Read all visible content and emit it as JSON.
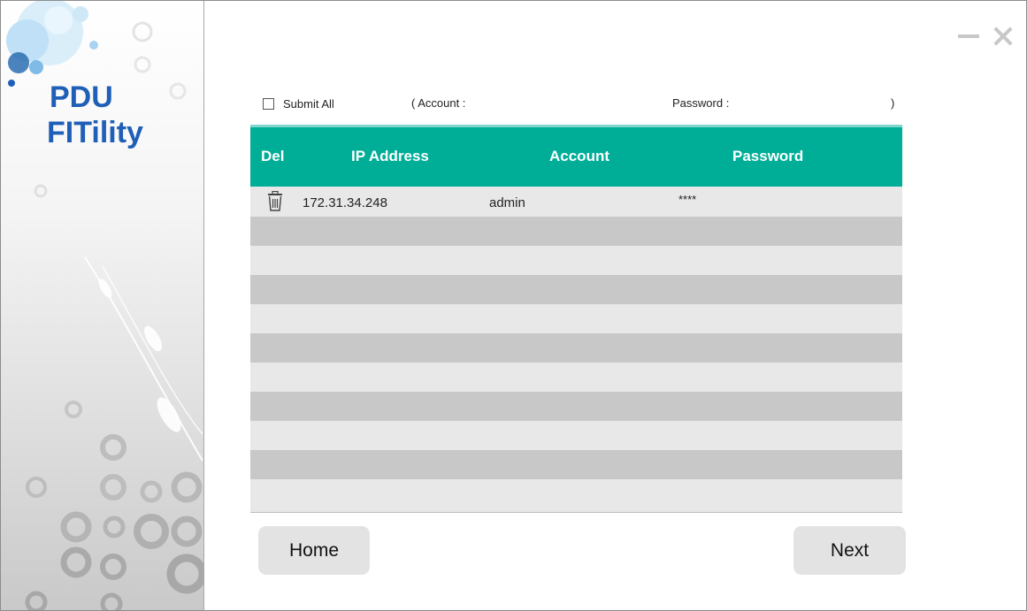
{
  "app": {
    "brand_line1": "PDU",
    "brand_line2": "FITility",
    "brand_color": "#1f5fb8",
    "accent_color": "#00ae98"
  },
  "window_controls": {
    "minimize_icon": "minimize-icon",
    "close_icon": "close-icon"
  },
  "form": {
    "submit_all_label": "Submit All",
    "submit_all_checked": false,
    "account_label": "( Account :",
    "password_label": "Password :",
    "close_paren": ")"
  },
  "table": {
    "columns": [
      "Del",
      "IP Address",
      "Account",
      "Password"
    ],
    "rows": [
      {
        "ip": "172.31.34.248",
        "account": "admin",
        "password": "****"
      },
      {
        "ip": "",
        "account": "",
        "password": ""
      },
      {
        "ip": "",
        "account": "",
        "password": ""
      },
      {
        "ip": "",
        "account": "",
        "password": ""
      },
      {
        "ip": "",
        "account": "",
        "password": ""
      },
      {
        "ip": "",
        "account": "",
        "password": ""
      },
      {
        "ip": "",
        "account": "",
        "password": ""
      },
      {
        "ip": "",
        "account": "",
        "password": ""
      },
      {
        "ip": "",
        "account": "",
        "password": ""
      },
      {
        "ip": "",
        "account": "",
        "password": ""
      },
      {
        "ip": "",
        "account": "",
        "password": ""
      }
    ]
  },
  "buttons": {
    "home": "Home",
    "next": "Next"
  }
}
